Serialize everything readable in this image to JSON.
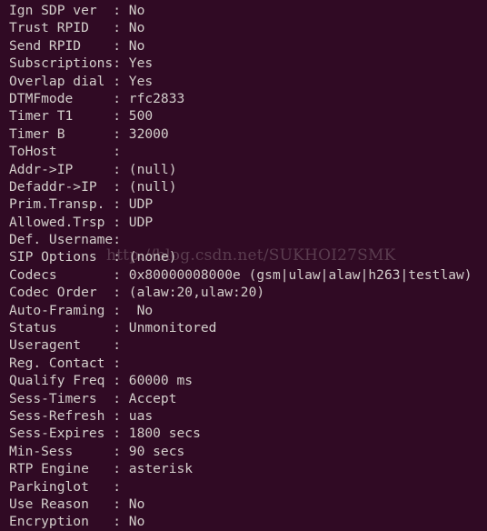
{
  "terminal": {
    "background_color": "#300a24",
    "text_color": "#d4cfcc",
    "watermark": "http://blog.csdn.net/SUKHOI27SMK",
    "lines": [
      "Ign SDP ver  : No",
      "Trust RPID   : No",
      "Send RPID    : No",
      "Subscriptions: Yes",
      "Overlap dial : Yes",
      "DTMFmode     : rfc2833",
      "Timer T1     : 500",
      "Timer B      : 32000",
      "ToHost       :",
      "Addr->IP     : (null)",
      "Defaddr->IP  : (null)",
      "Prim.Transp. : UDP",
      "Allowed.Trsp : UDP",
      "Def. Username:",
      "SIP Options  : (none)",
      "Codecs       : 0x80000008000e (gsm|ulaw|alaw|h263|testlaw)",
      "Codec Order  : (alaw:20,ulaw:20)",
      "Auto-Framing :  No",
      "Status       : Unmonitored",
      "Useragent    :",
      "Reg. Contact :",
      "Qualify Freq : 60000 ms",
      "Sess-Timers  : Accept",
      "Sess-Refresh : uas",
      "Sess-Expires : 1800 secs",
      "Min-Sess     : 90 secs",
      "RTP Engine   : asterisk",
      "Parkinglot   :",
      "Use Reason   : No",
      "Encryption   : No"
    ]
  }
}
